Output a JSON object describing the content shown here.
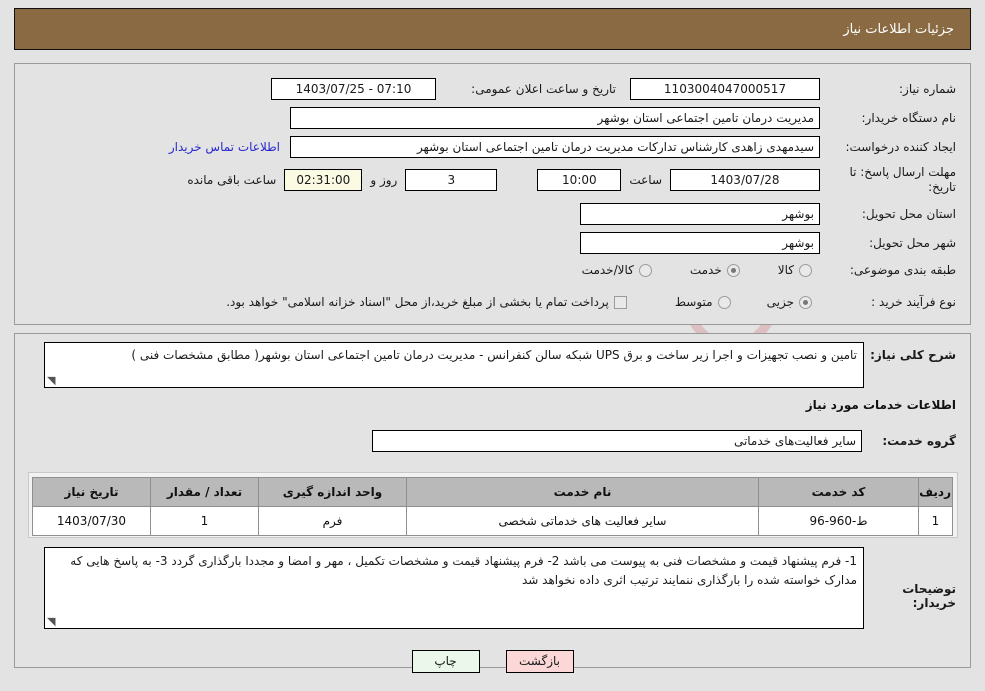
{
  "header": {
    "title": "جزئیات اطلاعات نیاز"
  },
  "watermark": {
    "text": "AriaTender.net"
  },
  "main": {
    "need_number_label": "شماره نیاز:",
    "need_number_value": "1103004047000517",
    "announce_datetime_label": "تاریخ و ساعت اعلان عمومی:",
    "announce_datetime_value": "07:10 - 1403/07/25",
    "buyer_org_label": "نام دستگاه خریدار:",
    "buyer_org_value": "مدیریت درمان تامین اجتماعی استان بوشهر",
    "requester_label": "ایجاد کننده درخواست:",
    "requester_value": "سیدمهدی زاهدی کارشناس تدارکات مدیریت درمان تامین اجتماعی استان بوشهر",
    "buyer_contact_link": "اطلاعات تماس خریدار",
    "deadline_label": "مهلت ارسال پاسخ: تا تاریخ:",
    "deadline_date": "1403/07/28",
    "deadline_hour_label": "ساعت",
    "deadline_hour_value": "10:00",
    "remaining_days_value": "3",
    "remaining_days_label": "روز و",
    "remaining_time_value": "02:31:00",
    "remaining_time_label": "ساعت باقی مانده",
    "delivery_province_label": "استان محل تحویل:",
    "delivery_province_value": "بوشهر",
    "delivery_city_label": "شهر محل تحویل:",
    "delivery_city_value": "بوشهر",
    "category_label": "طبقه بندی موضوعی:",
    "category_options": [
      {
        "label": "کالا",
        "selected": false
      },
      {
        "label": "خدمت",
        "selected": true
      },
      {
        "label": "کالا/خدمت",
        "selected": false
      }
    ],
    "process_type_label": "نوع فرآیند خرید :",
    "process_type_options": [
      {
        "label": "جزیی",
        "selected": true
      },
      {
        "label": "متوسط",
        "selected": false
      }
    ],
    "treasury_checkbox_label": "پرداخت تمام یا بخشی از مبلغ خرید،از محل \"اسناد خزانه اسلامی\" خواهد بود.",
    "treasury_checkbox_checked": false
  },
  "description": {
    "label": "شرح کلی نیاز:",
    "value": "تامین و نصب تجهیزات و اجرا زیر ساخت و برق UPS شبکه سالن کنفرانس - مدیریت درمان تامین اجتماعی استان بوشهر( مطابق مشخصات فنی )"
  },
  "services": {
    "section_title": "اطلاعات خدمات مورد نیاز",
    "group_label": "گروه خدمت:",
    "group_value": "سایر فعالیت‌های خدماتی",
    "table": {
      "headers": [
        "ردیف",
        "کد خدمت",
        "نام خدمت",
        "واحد اندازه گیری",
        "تعداد / مقدار",
        "تاریخ نیاز"
      ],
      "rows": [
        {
          "index": "1",
          "service_code": "ط-960-96",
          "service_name": "سایر فعالیت های خدماتی شخصی",
          "unit": "فرم",
          "quantity": "1",
          "need_date": "1403/07/30"
        }
      ]
    }
  },
  "buyer_notes": {
    "label": "توضیحات خریدار:",
    "value": "1- فرم پیشنهاد قیمت و مشخصات فنی به پیوست می باشد  2- فرم پیشنهاد قیمت و مشخصات تکمیل ، مهر و امضا و مجددا بارگذاری گردد  3- به پاسخ هایی که مدارک خواسته شده را بارگذاری ننمایند ترتیب اثری داده نخواهد شد"
  },
  "footer": {
    "print_label": "چاپ",
    "back_label": "بازگشت"
  }
}
